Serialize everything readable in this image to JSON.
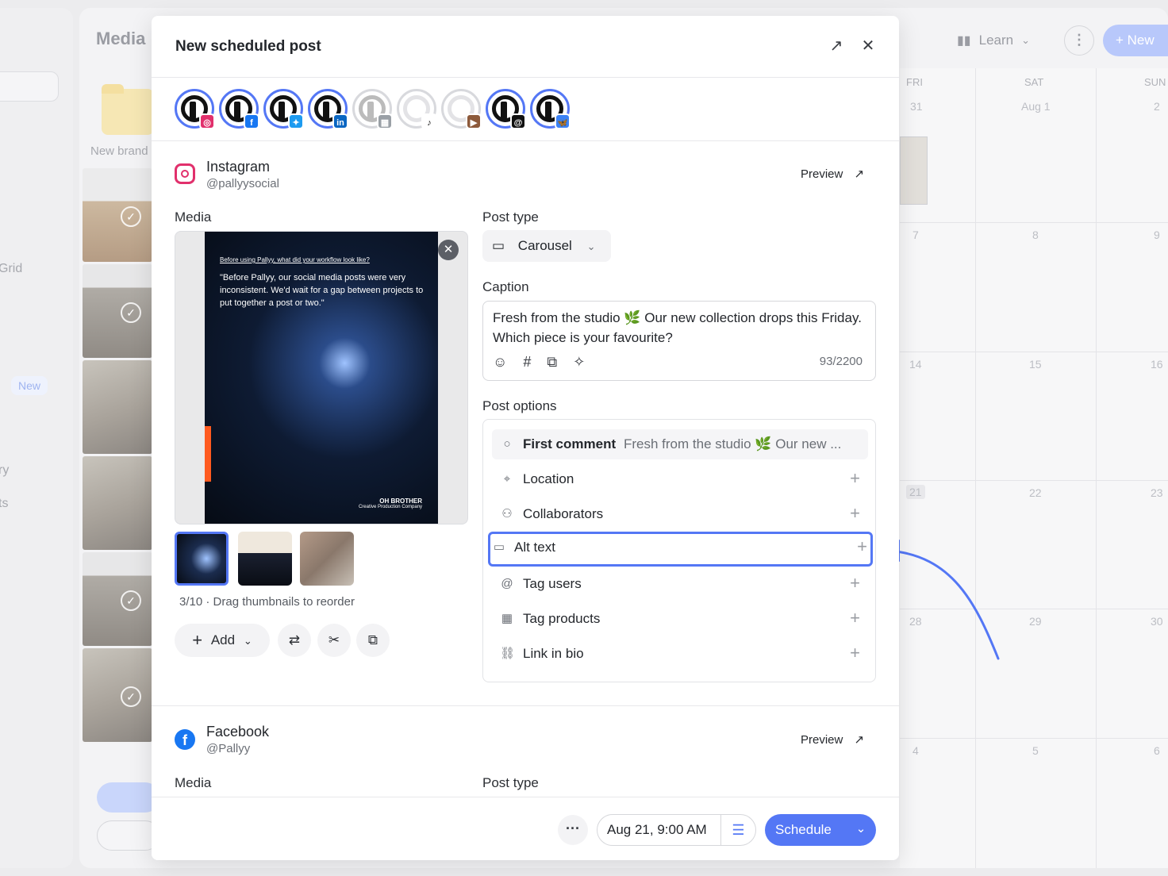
{
  "background": {
    "title": "Media",
    "new_brand": "New brand",
    "left_items": [
      "Grid",
      "New",
      "ry",
      "ts"
    ],
    "calendar": {
      "learn_label": "Learn",
      "new_label": "New",
      "days": [
        "FRI",
        "SAT",
        "SUN"
      ],
      "rows": [
        [
          "31",
          "Aug 1",
          "2"
        ],
        [
          "7",
          "8",
          "9"
        ],
        [
          "14",
          "15",
          "16"
        ],
        [
          "21",
          "22",
          "23"
        ],
        [
          "28",
          "29",
          "30"
        ],
        [
          "4",
          "5",
          "6"
        ]
      ]
    }
  },
  "modal": {
    "title": "New scheduled post",
    "accounts": [
      {
        "icon": "instagram-icon",
        "color": "#e1306c",
        "glyph": "◎",
        "selected": true
      },
      {
        "icon": "facebook-icon",
        "color": "#1877f2",
        "glyph": "f",
        "selected": true
      },
      {
        "icon": "twitter-icon",
        "color": "#1d9bf0",
        "glyph": "✦",
        "selected": true
      },
      {
        "icon": "linkedin-icon",
        "color": "#0a66c2",
        "glyph": "in",
        "selected": true
      },
      {
        "icon": "google-business-icon",
        "color": "#9aa0a6",
        "glyph": "▦",
        "selected": false
      },
      {
        "icon": "tiktok-icon",
        "color": "#ffffff",
        "glyph": "♪",
        "selected": false,
        "blank": true
      },
      {
        "icon": "youtube-icon",
        "color": "#8d5a3b",
        "glyph": "▶",
        "selected": false,
        "blank": true
      },
      {
        "icon": "threads-icon",
        "color": "#111111",
        "glyph": "@",
        "selected": true
      },
      {
        "icon": "bluesky-icon",
        "color": "#3b82f6",
        "glyph": "🦋",
        "selected": true
      }
    ],
    "instagram": {
      "name": "Instagram",
      "handle": "@pallyysocial",
      "preview_label": "Preview",
      "media_label": "Media",
      "slide": {
        "question": "Before using Pallyy, what did your workflow look like?",
        "quote": "\"Before Pallyy, our social media posts were very inconsistent. We'd wait for a gap between projects to put together a post or two.\"",
        "brand": "OH BROTHER",
        "brand_sub": "Creative Production Company"
      },
      "media_count": "3/10 · Drag thumbnails to reorder",
      "add_label": "Add",
      "post_type_label": "Post type",
      "post_type_value": "Carousel",
      "caption_label": "Caption",
      "caption_text": "Fresh from the studio 🌿 Our new collection drops this Friday. Which piece is your favourite?",
      "caption_count": "93/2200",
      "post_options_label": "Post options",
      "options": [
        {
          "label": "First comment",
          "value": "Fresh from the studio 🌿 Our new ...",
          "icon": "comment-icon"
        },
        {
          "label": "Location",
          "icon": "location-pin-icon"
        },
        {
          "label": "Collaborators",
          "icon": "users-icon"
        },
        {
          "label": "Alt text",
          "icon": "message-square-icon"
        },
        {
          "label": "Tag users",
          "icon": "at-sign-icon"
        },
        {
          "label": "Tag products",
          "icon": "store-icon"
        },
        {
          "label": "Link in bio",
          "icon": "link-icon"
        }
      ]
    },
    "facebook": {
      "name": "Facebook",
      "handle": "@Pallyy",
      "preview_label": "Preview",
      "media_label": "Media",
      "post_type_label": "Post type"
    },
    "footer": {
      "date": "Aug 21, 9:00 AM",
      "schedule_label": "Schedule"
    }
  },
  "colors": {
    "accent": "#5477f5"
  }
}
